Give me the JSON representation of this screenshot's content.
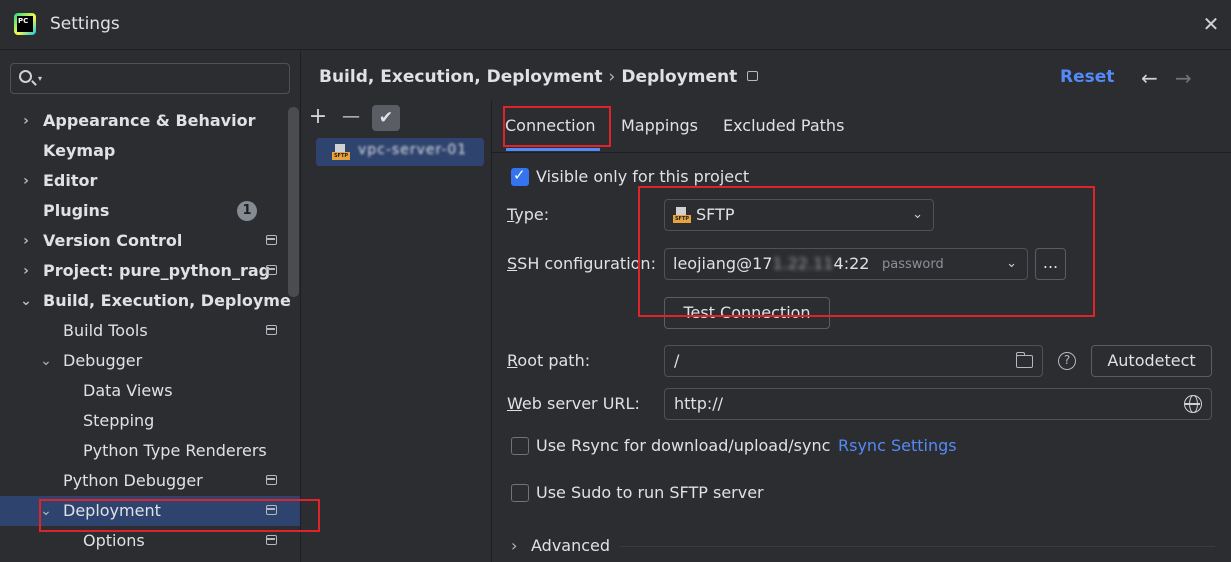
{
  "window": {
    "title": "Settings",
    "app_icon_text": "PC",
    "close_glyph": "✕"
  },
  "search": {
    "value": "",
    "placeholder": ""
  },
  "tree": {
    "items": [
      {
        "label": "Appearance & Behavior"
      },
      {
        "label": "Keymap"
      },
      {
        "label": "Editor"
      },
      {
        "label": "Plugins",
        "badge": "1"
      },
      {
        "label": "Version Control"
      },
      {
        "label": "Project: pure_python_rag"
      },
      {
        "label": "Build, Execution, Deployme"
      },
      {
        "label": "Build Tools"
      },
      {
        "label": "Debugger"
      },
      {
        "label": "Data Views"
      },
      {
        "label": "Stepping"
      },
      {
        "label": "Python Type Renderers"
      },
      {
        "label": "Python Debugger"
      },
      {
        "label": "Deployment"
      },
      {
        "label": "Options"
      }
    ]
  },
  "header": {
    "breadcrumb": [
      "Build, Execution, Deployment",
      "Deployment"
    ],
    "separator": "›",
    "reset_label": "Reset",
    "back_glyph": "←",
    "forward_glyph": "→"
  },
  "server_list": {
    "add_glyph": "+",
    "remove_glyph": "—",
    "check_glyph": "✔",
    "servers": [
      {
        "name": "vpc-server-01",
        "type_tag": "SFTP"
      }
    ]
  },
  "tabs": [
    {
      "label": "Connection",
      "active": true
    },
    {
      "label": "Mappings",
      "active": false
    },
    {
      "label": "Excluded Paths",
      "active": false
    }
  ],
  "connection": {
    "visible_only": {
      "label": "Visible only for this project",
      "checked": true
    },
    "type": {
      "label_prefix": "",
      "label_mnemonic": "T",
      "label_rest": "ype:",
      "value": "SFTP",
      "icon_tag": "SFTP"
    },
    "ssh": {
      "label_mnemonic": "S",
      "label_rest": "SH configuration:",
      "value_prefix": "leojiang@17",
      "value_masked": "1.22.11",
      "value_suffix": "4:22",
      "auth_hint": "password",
      "browse_label": "..."
    },
    "test_connection_label": "Test Connection",
    "root_path": {
      "label_mnemonic": "R",
      "label_rest": "oot path:",
      "value": "/",
      "help_glyph": "?",
      "autodetect_label": "Autodetect"
    },
    "web_url": {
      "label_mnemonic": "W",
      "label_rest": "eb server URL:",
      "value": "http://"
    },
    "rsync": {
      "label": "Use Rsync for download/upload/sync",
      "checked": false,
      "link_label": "Rsync Settings"
    },
    "sudo": {
      "label": "Use Sudo to run SFTP server",
      "checked": false
    },
    "advanced": {
      "label": "Advanced",
      "chevron_glyph": "›"
    }
  },
  "colors": {
    "accent": "#548af7",
    "selection": "#2e436e",
    "annotation_red": "#e0232a",
    "background": "#2b2d30"
  }
}
